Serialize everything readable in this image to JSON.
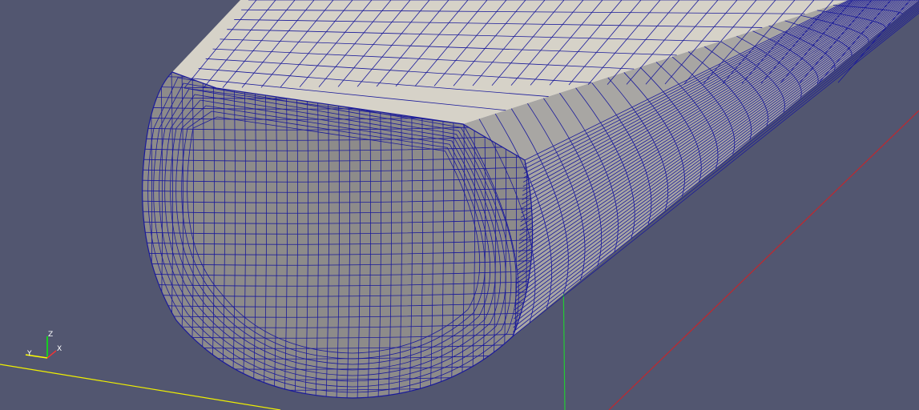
{
  "viewport": {
    "background": "#525670",
    "face_color": "#8d8b8a",
    "top_color": "#d6d2c8",
    "side_color": "#a8a6a3",
    "mesh_color": "#1a1a9a"
  },
  "axes": {
    "x_label": "X",
    "y_label": "Y",
    "z_label": "Z",
    "x_color": "#ff3030",
    "y_color": "#ffff00",
    "z_color": "#00ff00"
  },
  "scene_lines": {
    "red_color": "#c0282e",
    "yellow_color": "#f0f000",
    "green_color": "#22cc33"
  }
}
